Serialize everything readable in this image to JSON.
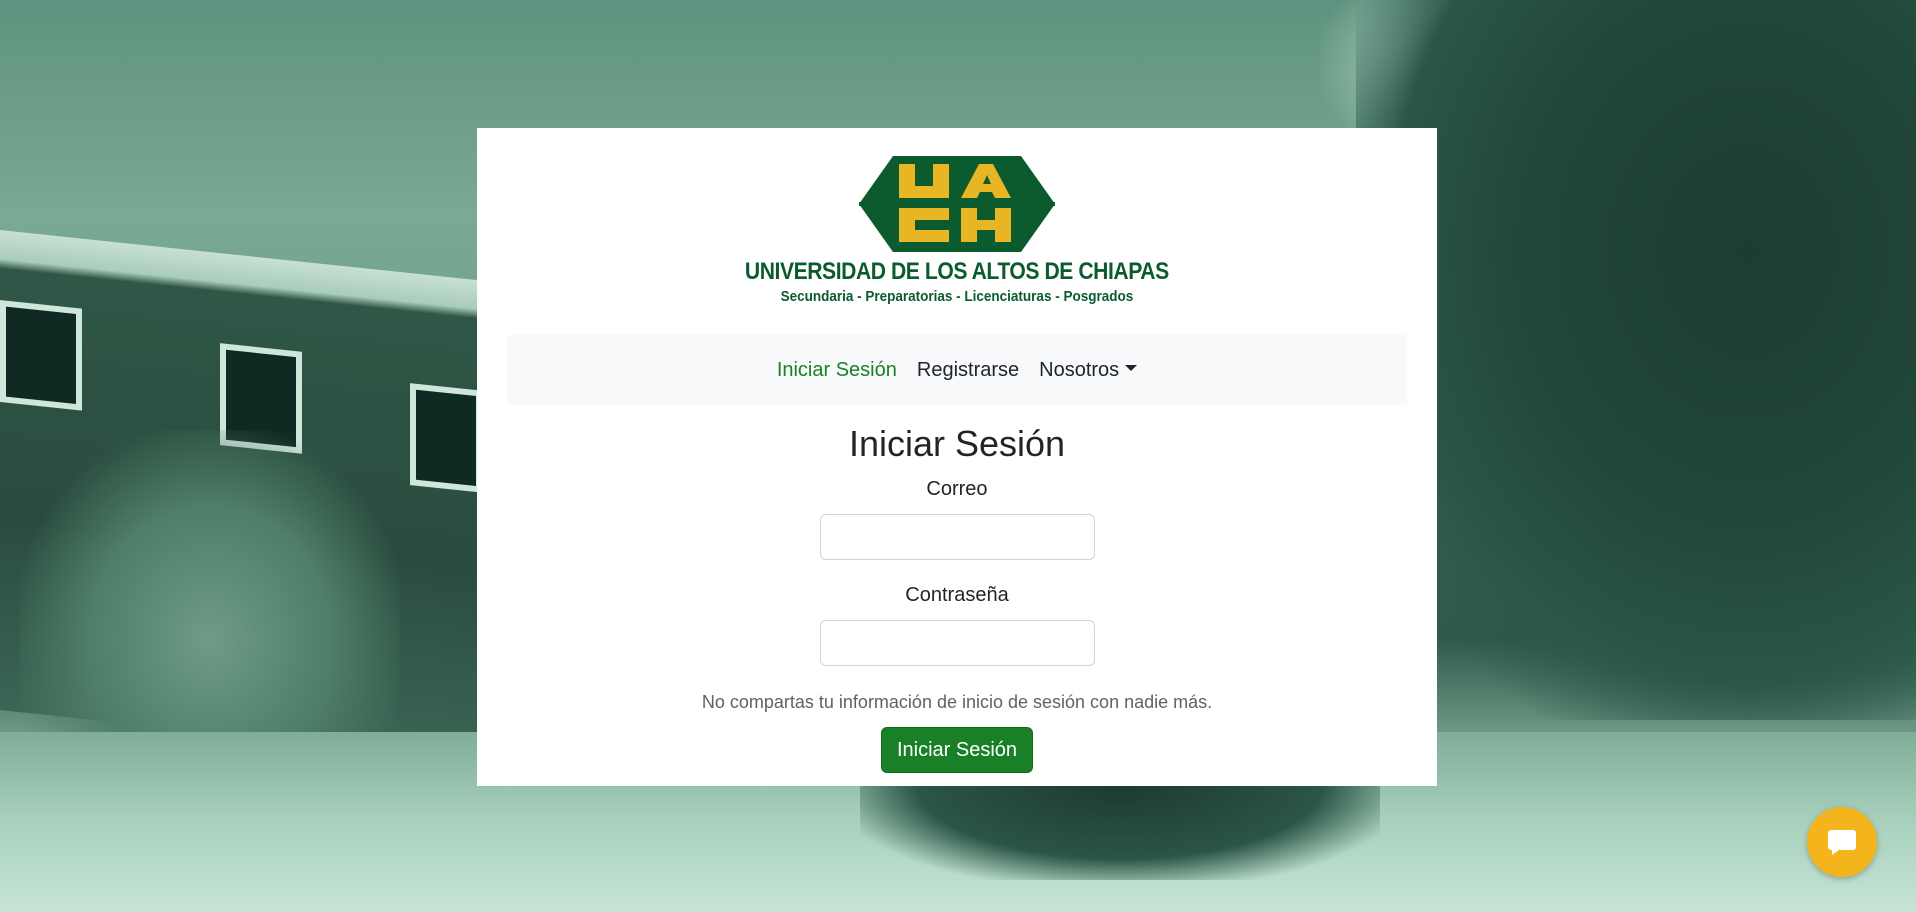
{
  "brand": {
    "mark_letters": "UACH",
    "name": "UNIVERSIDAD DE LOS ALTOS DE CHIAPAS",
    "tagline": "Secundaria - Preparatorias - Licenciaturas - Posgrados",
    "colors": {
      "green": "#0b5b2f",
      "gold": "#e8b624"
    }
  },
  "nav": {
    "items": [
      {
        "label": "Iniciar Sesión",
        "active": true
      },
      {
        "label": "Registrarse",
        "active": false
      },
      {
        "label": "Nosotros",
        "active": false,
        "dropdown": true
      }
    ]
  },
  "login": {
    "title": "Iniciar Sesión",
    "email_label": "Correo",
    "email_value": "",
    "password_label": "Contraseña",
    "password_value": "",
    "help_text": "No compartas tu información de inicio de sesión con nadie más.",
    "submit_label": "Iniciar Sesión"
  },
  "chat": {
    "icon": "chat-bubble-icon",
    "color": "#f4b51c"
  },
  "theme": {
    "accent": "#198027",
    "navbar_bg": "#f8f9fa"
  }
}
